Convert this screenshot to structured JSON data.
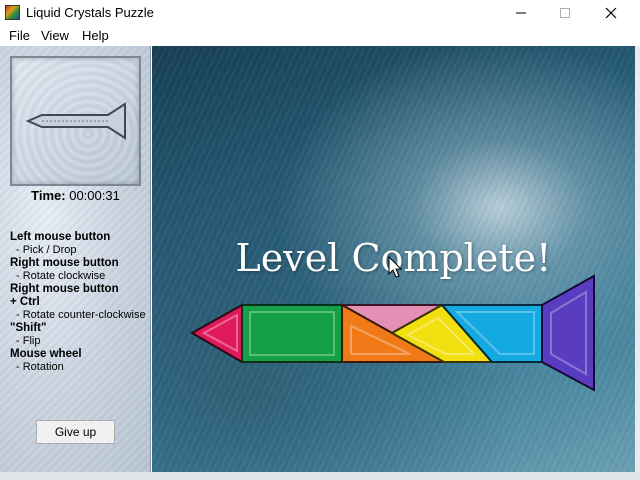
{
  "window": {
    "title": "Liquid Crystals Puzzle",
    "controls": [
      "minimize-icon",
      "maximize-icon",
      "close-icon"
    ]
  },
  "menu": {
    "file": "File",
    "view": "View",
    "help": "Help"
  },
  "sidebar": {
    "time_label": "Time:",
    "time_value": "00:00:31",
    "help": [
      {
        "heading": "Left mouse button",
        "desc": "- Pick / Drop"
      },
      {
        "heading": "Right mouse button",
        "desc": "- Rotate clockwise"
      },
      {
        "heading": "Right mouse button",
        "heading2": "+ Ctrl",
        "desc": "- Rotate counter-clockwise"
      },
      {
        "heading": "\"Shift\"",
        "desc": "- Flip"
      },
      {
        "heading": "Mouse wheel",
        "desc": "- Rotation"
      }
    ],
    "give_up_label": "Give up"
  },
  "board": {
    "message": "Level Complete!",
    "piece_colors": {
      "red": "#e0195a",
      "green": "#16a046",
      "orange": "#f07a18",
      "pink": "#e48fb6",
      "yellow": "#f2df10",
      "cyan": "#14a9e0",
      "purple": "#5a3cc0"
    }
  }
}
